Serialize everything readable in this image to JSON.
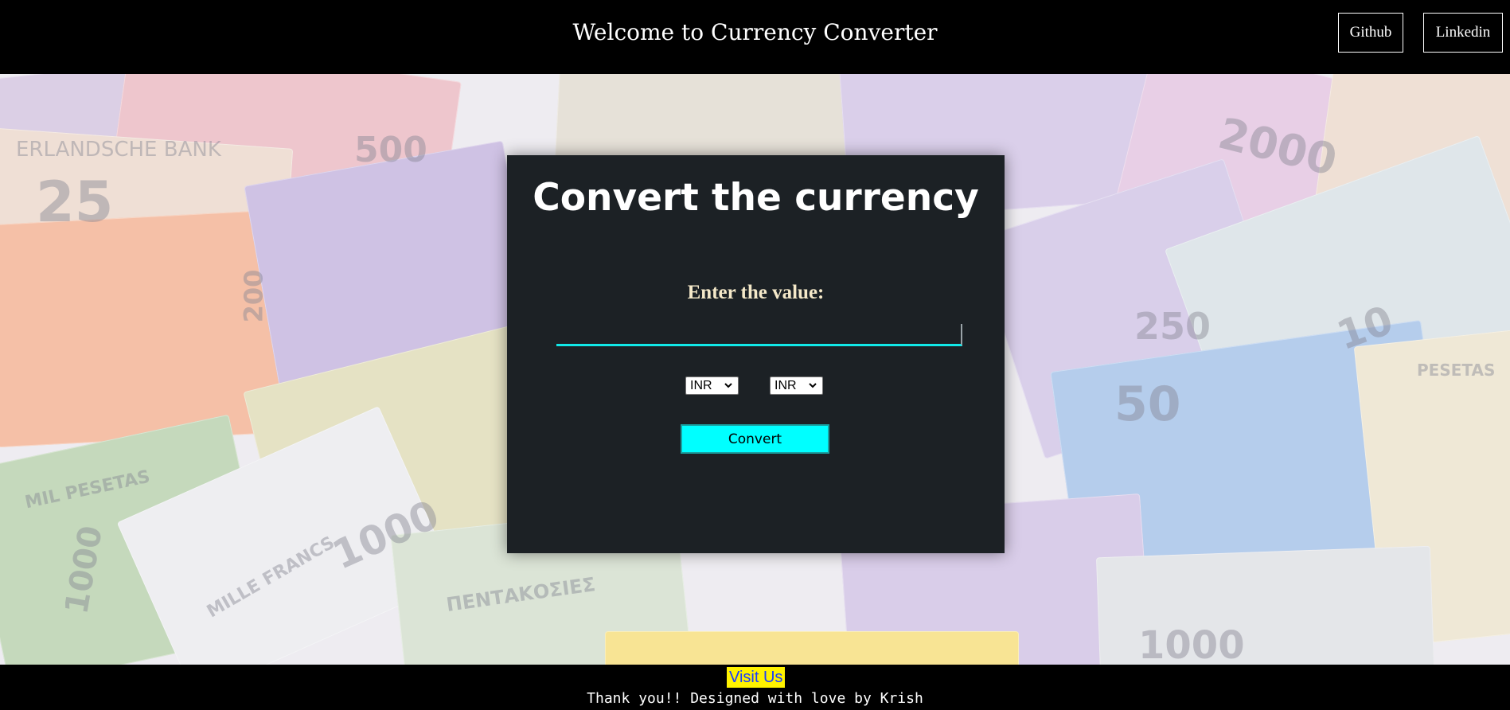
{
  "header": {
    "title": "Welcome to Currency Converter",
    "links": [
      "Github",
      "Linkedin"
    ]
  },
  "background": {
    "description_icon": "banknote-collage-image",
    "note_labels": [
      "500",
      "25",
      "200",
      "1000",
      "2000",
      "250",
      "10",
      "50",
      "1000",
      "MILLE FRANCS",
      "ΠΕΝΤΑΚΟΣΙΕΣ",
      "1000",
      "ERLANDSCHE BANK",
      "MIL PESETAS",
      "PESETAS"
    ]
  },
  "converter": {
    "heading": "Convert the currency",
    "value_label": "Enter the value:",
    "value_input": "",
    "from_currency": "INR",
    "to_currency": "INR",
    "convert_label": "Convert"
  },
  "footer": {
    "visit_label": "Visit Us",
    "credit": "Thank you!! Designed with love by Krish"
  },
  "colors": {
    "accent": "#00ffff",
    "card": "#1c2125",
    "header": "#000000",
    "link_highlight": "#fff200"
  }
}
